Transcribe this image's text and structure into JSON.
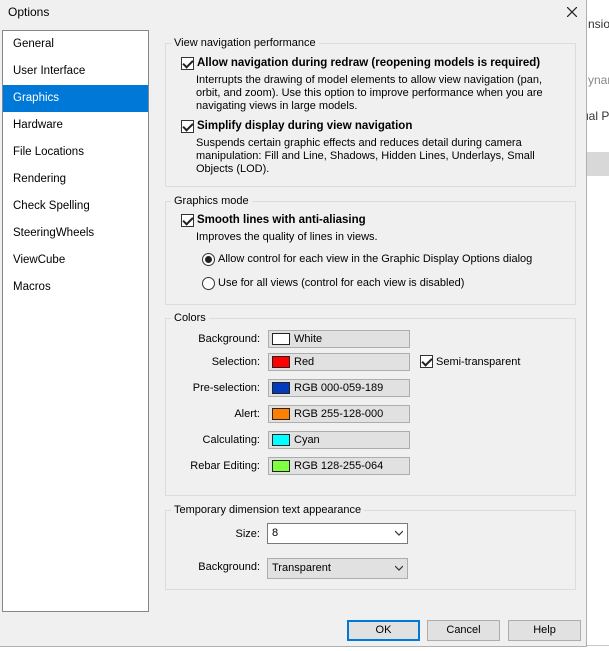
{
  "dialog": {
    "title": "Options"
  },
  "background_app": {
    "fragments": [
      "nsio",
      "ynar",
      "ual Pu"
    ]
  },
  "nav": {
    "items": [
      "General",
      "User Interface",
      "Graphics",
      "Hardware",
      "File Locations",
      "Rendering",
      "Check Spelling",
      "SteeringWheels",
      "ViewCube",
      "Macros"
    ],
    "active_index": 2
  },
  "view_nav": {
    "legend": "View navigation performance",
    "opt1": {
      "label": "Allow navigation during redraw (reopening models is required)",
      "checked": true,
      "desc": "Interrupts the drawing of model elements to allow view navigation (pan, orbit, and zoom). Use this option to improve performance when you are navigating views in large models."
    },
    "opt2": {
      "label": "Simplify display during view navigation",
      "checked": true,
      "desc": "Suspends certain graphic effects and reduces detail during camera manipulation: Fill and Line, Shadows, Hidden Lines, Underlays, Small Objects (LOD)."
    }
  },
  "graphics_mode": {
    "legend": "Graphics mode",
    "smooth": {
      "label": "Smooth lines with anti-aliasing",
      "checked": true,
      "desc": "Improves the quality of lines in views."
    },
    "radio1": {
      "label": "Allow control for each view in the Graphic Display Options dialog",
      "selected": true
    },
    "radio2": {
      "label": "Use for all views (control for each view is disabled)",
      "selected": false
    }
  },
  "colors": {
    "legend": "Colors",
    "rows": [
      {
        "label": "Background:",
        "name": "White",
        "hex": "#ffffff"
      },
      {
        "label": "Selection:",
        "name": "Red",
        "hex": "#ff0000"
      },
      {
        "label": "Pre-selection:",
        "name": "RGB 000-059-189",
        "hex": "#003bbd"
      },
      {
        "label": "Alert:",
        "name": "RGB 255-128-000",
        "hex": "#ff8000"
      },
      {
        "label": "Calculating:",
        "name": "Cyan",
        "hex": "#00ffff"
      },
      {
        "label": "Rebar Editing:",
        "name": "RGB 128-255-064",
        "hex": "#80ff40"
      }
    ],
    "semi_transparent": {
      "label": "Semi-transparent",
      "checked": true
    }
  },
  "temp_dim": {
    "legend": "Temporary dimension text appearance",
    "size_label": "Size:",
    "size_value": "8",
    "bg_label": "Background:",
    "bg_value": "Transparent"
  },
  "buttons": {
    "ok": "OK",
    "cancel": "Cancel",
    "help": "Help"
  },
  "accent": "#0078d7"
}
